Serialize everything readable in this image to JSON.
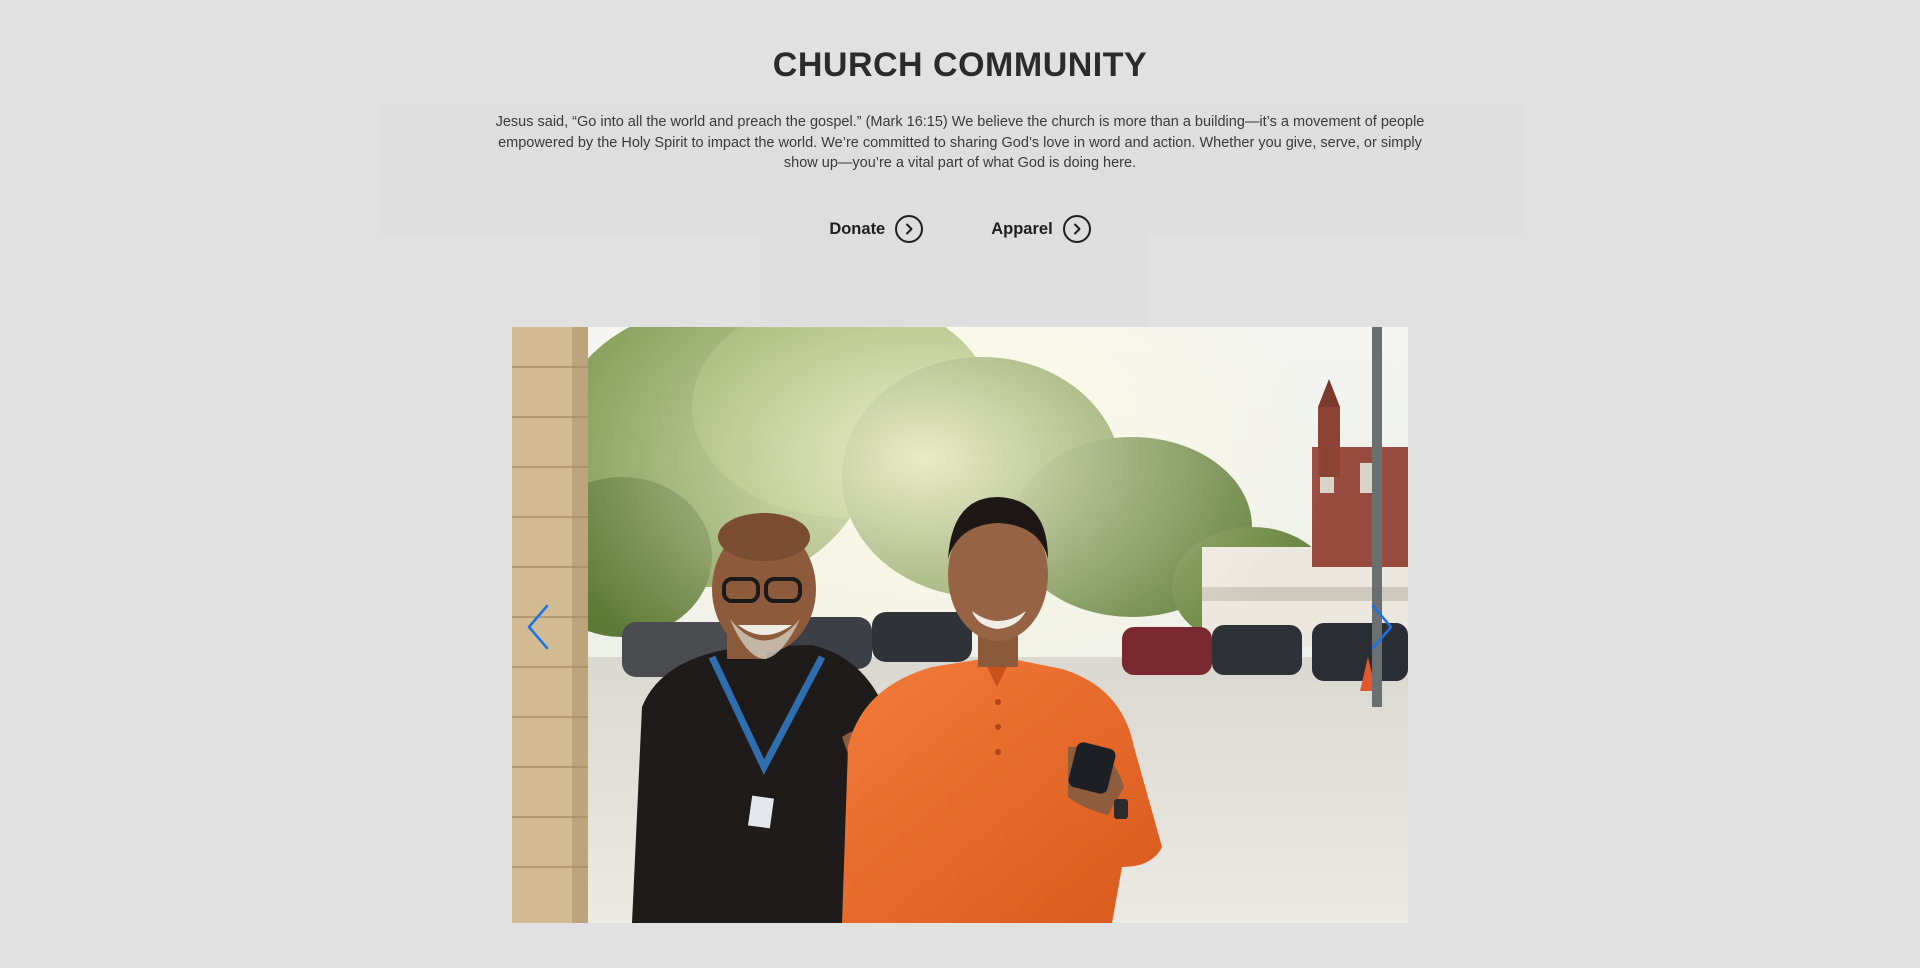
{
  "hero": {
    "title": "CHURCH COMMUNITY",
    "description": "Jesus said, “Go into all the world and preach the gospel.” (Mark 16:15) We believe the church is more than a building—it’s a movement of people empowered by the Holy Spirit to impact the world. We’re committed to sharing God’s love in word and action. Whether you give, serve, or simply show up—you’re a vital part of what God is doing here."
  },
  "actions": [
    {
      "label": "Donate",
      "icon": "chevron-right-circle-icon"
    },
    {
      "label": "Apparel",
      "icon": "chevron-right-circle-icon"
    }
  ],
  "carousel": {
    "prev_icon": "chevron-left-icon",
    "next_icon": "chevron-right-icon",
    "arrow_color": "#1a73e8"
  },
  "colors": {
    "background": "#e1e1e1",
    "heading": "#2b2b2b",
    "body_text": "#3a3a3a"
  }
}
